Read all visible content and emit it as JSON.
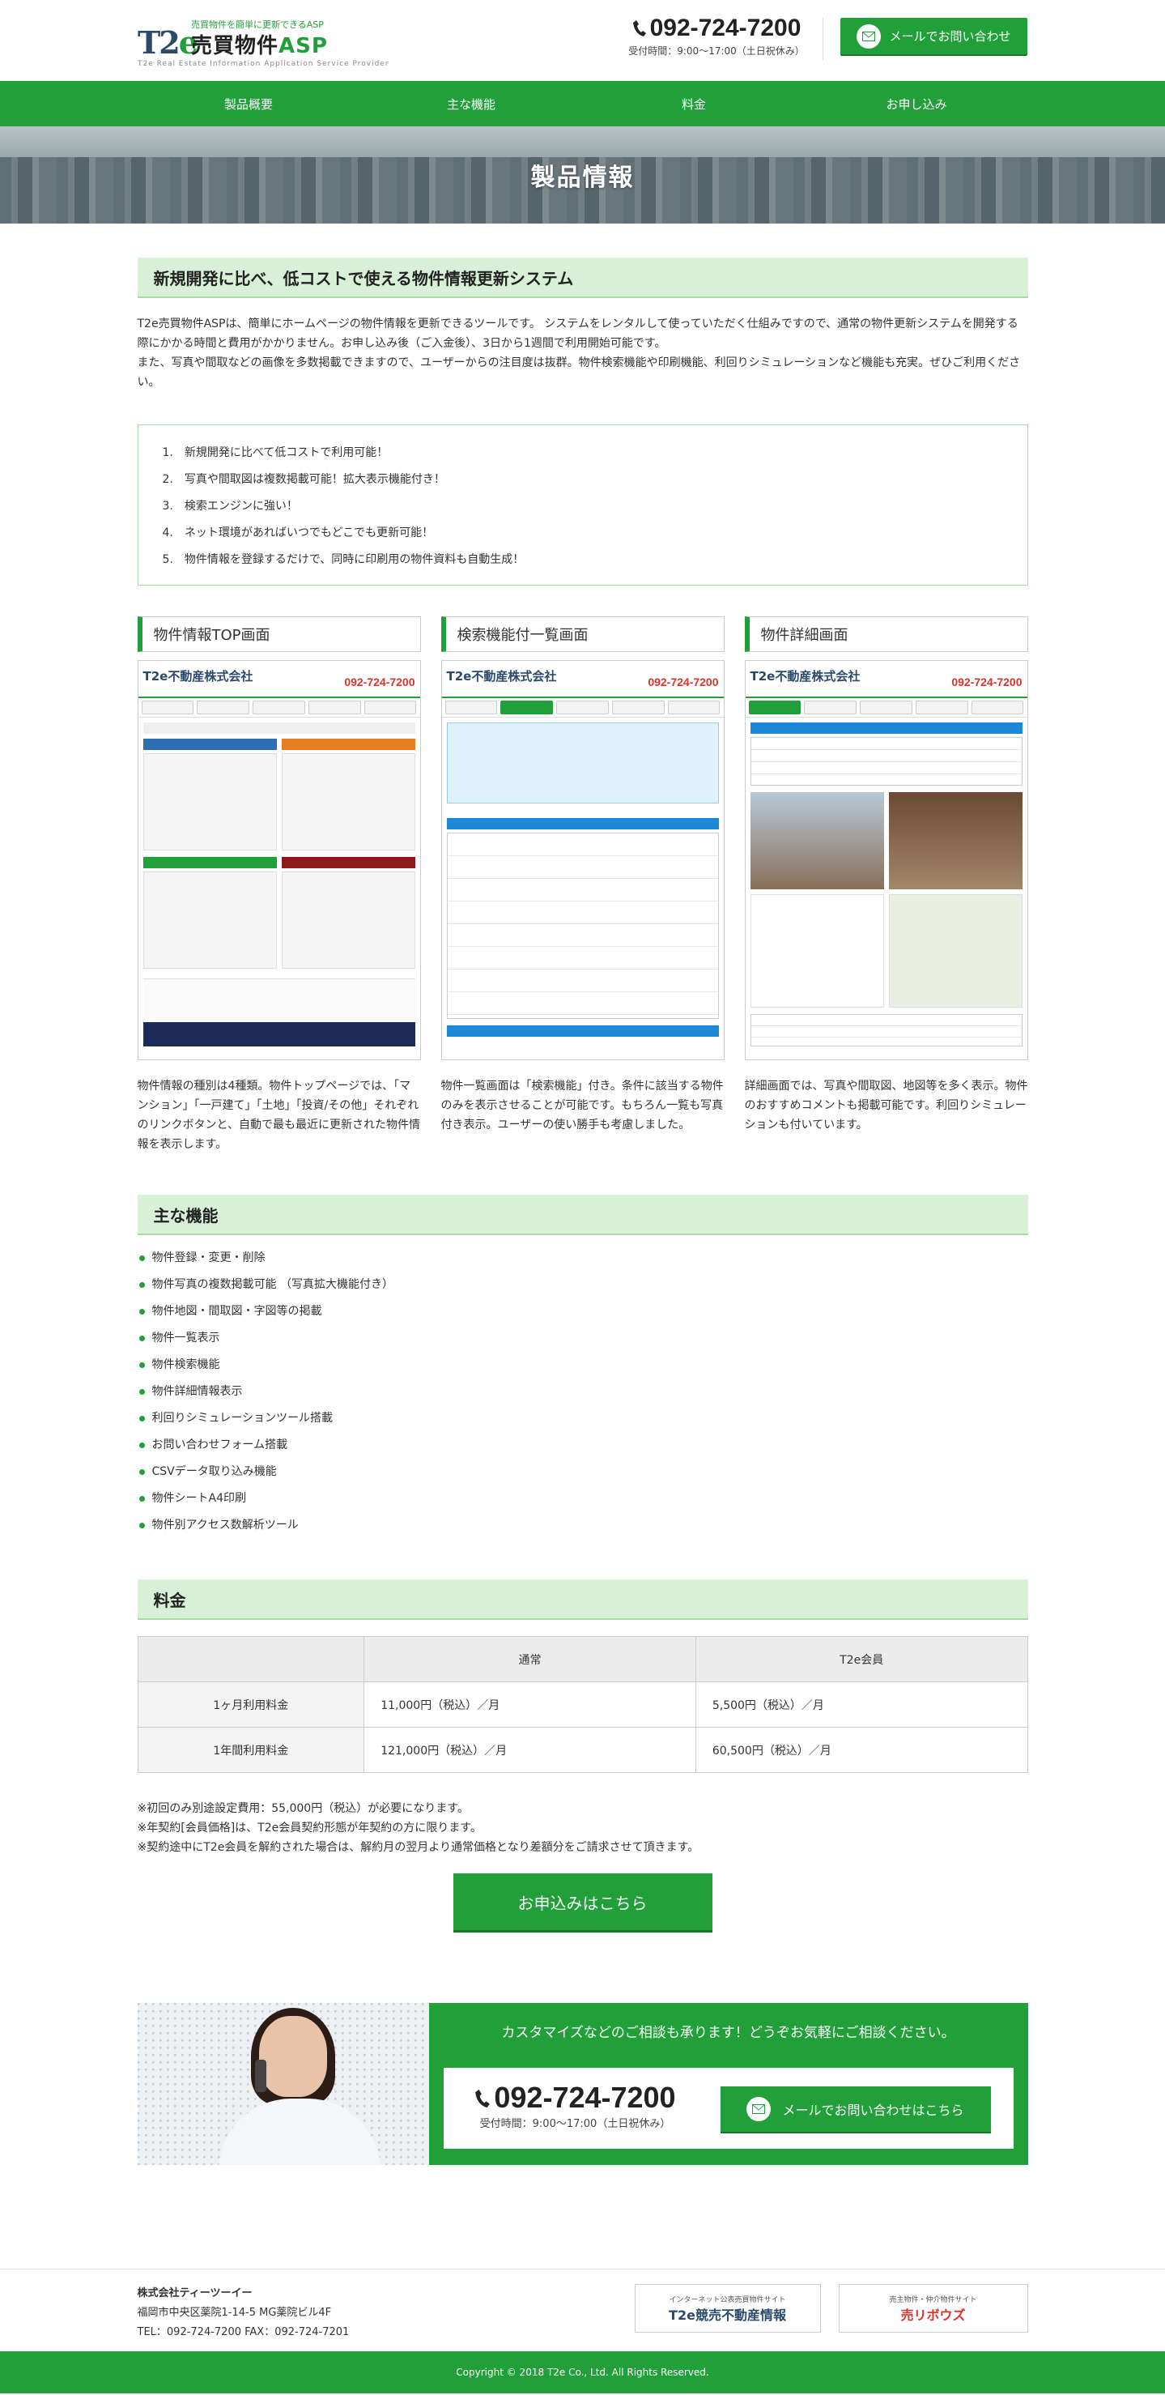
{
  "header": {
    "logo_mark": "T2e",
    "logo_tagline": "売買物件を簡単に更新できるASP",
    "logo_name": "売買物件",
    "logo_name_accent": "ASP",
    "logo_sub": "T2e Real Estate Information Application Service Provider",
    "phone": "092-724-7200",
    "hours": "受付時間：9:00〜17:00（土日祝休み）",
    "mail_button": "メールでお問い合わせ"
  },
  "nav": {
    "items": [
      "製品概要",
      "主な機能",
      "料金",
      "お申し込み"
    ]
  },
  "hero": {
    "title": "製品情報"
  },
  "overview": {
    "heading": "新規開発に比べ、低コストで使える物件情報更新システム",
    "intro_1": "T2e売買物件ASPは、簡単にホームページの物件情報を更新できるツールです。 システムをレンタルして使っていただく仕組みですので、通常の物件更新システムを開発する際にかかる時間と費用がかかりません。お申し込み後（ご入金後）、3日から1週間で利用開始可能です。",
    "intro_2": "また、写真や間取などの画像を多数掲載できますので、ユーザーからの注目度は抜群。物件検索機能や印刷機能、利回りシミュレーションなど機能も充実。ぜひご利用ください。",
    "points": [
      "1.　新規開発に比べて低コストで利用可能！",
      "2.　写真や間取図は複数掲載可能！拡大表示機能付き！",
      "3.　検索エンジンに強い！",
      "4.　ネット環境があればいつでもどこでも更新可能！",
      "5.　物件情報を登録するだけで、同時に印刷用の物件資料も自動生成！"
    ]
  },
  "screens": [
    {
      "title": "物件情報TOP画面",
      "shot_logo": "T2e不動産株式会社",
      "shot_tel": "092-724-7200",
      "desc": "物件情報の種別は4種類。物件トップページでは、「マンション」「一戸建て」「土地」「投資/その他」それぞれのリンクボタンと、自動で最も最近に更新された物件情報を表示します。"
    },
    {
      "title": "検索機能付一覧画面",
      "shot_logo": "T2e不動産株式会社",
      "shot_tel": "092-724-7200",
      "desc": "物件一覧画面は「検索機能」付き。条件に該当する物件のみを表示させることが可能です。もちろん一覧も写真付き表示。ユーザーの使い勝手も考慮しました。"
    },
    {
      "title": "物件詳細画面",
      "shot_logo": "T2e不動産株式会社",
      "shot_tel": "092-724-7200",
      "desc": "詳細画面では、写真や間取図、地図等を多く表示。物件のおすすめコメントも掲載可能です。利回りシミュレーションも付いています。"
    }
  ],
  "features": {
    "heading": "主な機能",
    "items": [
      "物件登録・変更・削除",
      "物件写真の複数掲載可能 （写真拡大機能付き）",
      "物件地図・間取図・字図等の掲載",
      "物件一覧表示",
      "物件検索機能",
      "物件詳細情報表示",
      "利回りシミュレーションツール搭載",
      "お問い合わせフォーム搭載",
      "CSVデータ取り込み機能",
      "物件シートA4印刷",
      "物件別アクセス数解析ツール"
    ]
  },
  "price": {
    "heading": "料金",
    "columns": [
      "",
      "通常",
      "T2e会員"
    ],
    "rows": [
      {
        "label": "1ヶ月利用料金",
        "normal": "11,000円（税込）／月",
        "member": "5,500円（税込）／月"
      },
      {
        "label": "1年間利用料金",
        "normal": "121,000円（税込）／月",
        "member": "60,500円（税込）／月"
      }
    ],
    "notes": [
      "※初回のみ別途設定費用：55,000円（税込）が必要になります。",
      "※年契約[会員価格]は、T2e会員契約形態が年契約の方に限ります。",
      "※契約途中にT2e会員を解約された場合は、解約月の翌月より通常価格となり差額分をご請求させて頂きます。"
    ],
    "apply_button": "お申込みはこちら"
  },
  "contact": {
    "title": "カスタマイズなどのご相談も承ります！どうぞお気軽にご相談ください。",
    "phone": "092-724-7200",
    "hours": "受付時間：9:00〜17:00（土日祝休み）",
    "mail_button": "メールでお問い合わせはこちら"
  },
  "footer": {
    "company": "株式会社ティーツーイー",
    "address": "福岡市中央区薬院1-14-5 MG薬院ビル4F",
    "tel": "TEL：092-724-7200 FAX：092-724-7201",
    "banner1_small": "インターネット公表売買物件サイト",
    "banner1": "T2e競売不動産情報",
    "banner2_small": "売主物件・仲介物件サイト",
    "banner2": "売リボウズ",
    "copyright": "Copyright © 2018 T2e Co., Ltd. All Rights Reserved."
  },
  "colors": {
    "brand_green": "#21a03a",
    "heading_bg": "#d8f0d8",
    "tel_red": "#d9342b"
  }
}
